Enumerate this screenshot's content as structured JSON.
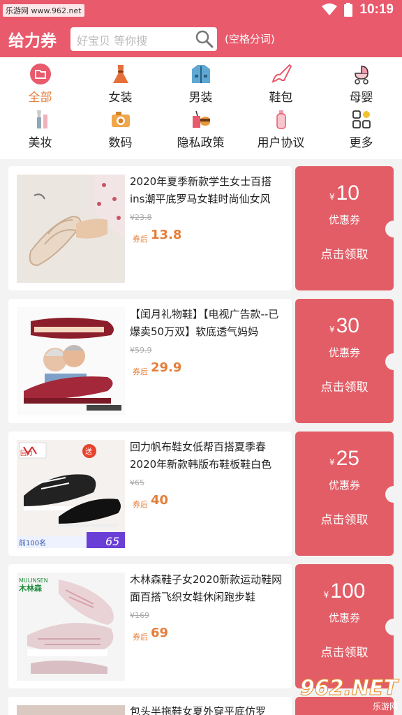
{
  "status_bar": {
    "watermark": "乐游网 www.962.net",
    "time": "10:19"
  },
  "header": {
    "brand": "给力券",
    "search_placeholder": "好宝贝 等你搜",
    "search_hint": "(空格分词)"
  },
  "categories": [
    {
      "label": "全部",
      "icon": "folder-icon",
      "active": true
    },
    {
      "label": "女装",
      "icon": "dress-icon"
    },
    {
      "label": "男装",
      "icon": "jacket-icon"
    },
    {
      "label": "鞋包",
      "icon": "high-heel-icon"
    },
    {
      "label": "母婴",
      "icon": "stroller-icon"
    },
    {
      "label": "美妆",
      "icon": "makeup-brush-icon"
    },
    {
      "label": "数码",
      "icon": "camera-icon"
    },
    {
      "label": "隐私政策",
      "icon": "fast-food-icon"
    },
    {
      "label": "用户协议",
      "icon": "bottle-icon"
    },
    {
      "label": "更多",
      "icon": "grid-icon"
    }
  ],
  "products": [
    {
      "title": "2020年夏季新款学生女士百搭ins潮平底罗马女鞋时尚仙女风",
      "orig_price": "¥23.8",
      "after_label": "券后",
      "after_price": "13.8",
      "coupon_yen": "¥",
      "coupon_amount": "10",
      "coupon_label": "优惠券",
      "claim_label": "点击领取"
    },
    {
      "title": "【闰月礼物鞋】【电视广告款--已爆卖50万双】软底透气妈妈",
      "orig_price": "¥59.9",
      "after_label": "券后",
      "after_price": "29.9",
      "coupon_yen": "¥",
      "coupon_amount": "30",
      "coupon_label": "优惠券",
      "claim_label": "点击领取"
    },
    {
      "title": "回力帆布鞋女低帮百搭夏季春2020年新款韩版布鞋板鞋白色",
      "orig_price": "¥65",
      "after_label": "券后",
      "after_price": "40",
      "coupon_yen": "¥",
      "coupon_amount": "25",
      "coupon_label": "优惠券",
      "claim_label": "点击领取"
    },
    {
      "title": "木林森鞋子女2020新款运动鞋网面百搭飞织女鞋休闲跑步鞋",
      "orig_price": "¥169",
      "after_label": "券后",
      "after_price": "69",
      "coupon_yen": "¥",
      "coupon_amount": "100",
      "coupon_label": "优惠券",
      "claim_label": "点击领取"
    }
  ],
  "partial_product": {
    "title": "包头半拖鞋女夏外穿平底仿罗"
  },
  "image_texts": {
    "p3_brand": "回力",
    "p3_badge": "送",
    "p3_banner": "前100名",
    "p3_price_tag": "65",
    "p4_brand_en": "MULINSEN",
    "p4_brand_cn": "木林森"
  },
  "watermark": {
    "big": "962.NET",
    "small": "乐游网"
  }
}
